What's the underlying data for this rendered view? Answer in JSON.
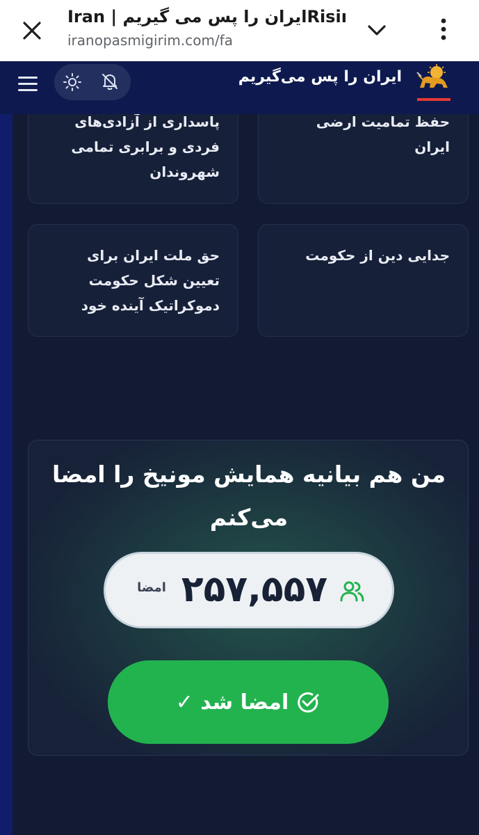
{
  "browser": {
    "title": "Iran | ایران را پس می گیریمRising",
    "url": "iranopasmigirim.com/fa"
  },
  "header": {
    "brand": "ایران را پس می‌گیریم"
  },
  "cards": [
    "پاسداری از آزادی‌های فردی و برابری تمامی شهروندان",
    "حفظ تمامیت ارضی ایران",
    "حق ملت ایران برای تعیین شکل حکومت دموکراتیک آینده خود",
    "جدایی دین از حکومت"
  ],
  "petition": {
    "heading": "من هم بیانیه همایش مونیخ را امضا می‌کنم",
    "count": "۲۵۷,۵۵۷",
    "count_label": "امضا",
    "signed_label": "امضا شد ✓"
  },
  "colors": {
    "header_bg": "#0e1a4f",
    "page_bg": "#131b33",
    "card_bg": "#172039",
    "accent_green": "#22b34f",
    "logo_underline": "#e53935"
  },
  "icons": {
    "close": "close-icon",
    "chevron": "chevron-down-icon",
    "more": "more-vertical-icon",
    "menu": "menu-icon",
    "sun": "sun-icon",
    "bell": "bell-off-icon",
    "logo": "lion-and-sun-logo",
    "users": "users-icon",
    "check": "check-circle-icon"
  }
}
